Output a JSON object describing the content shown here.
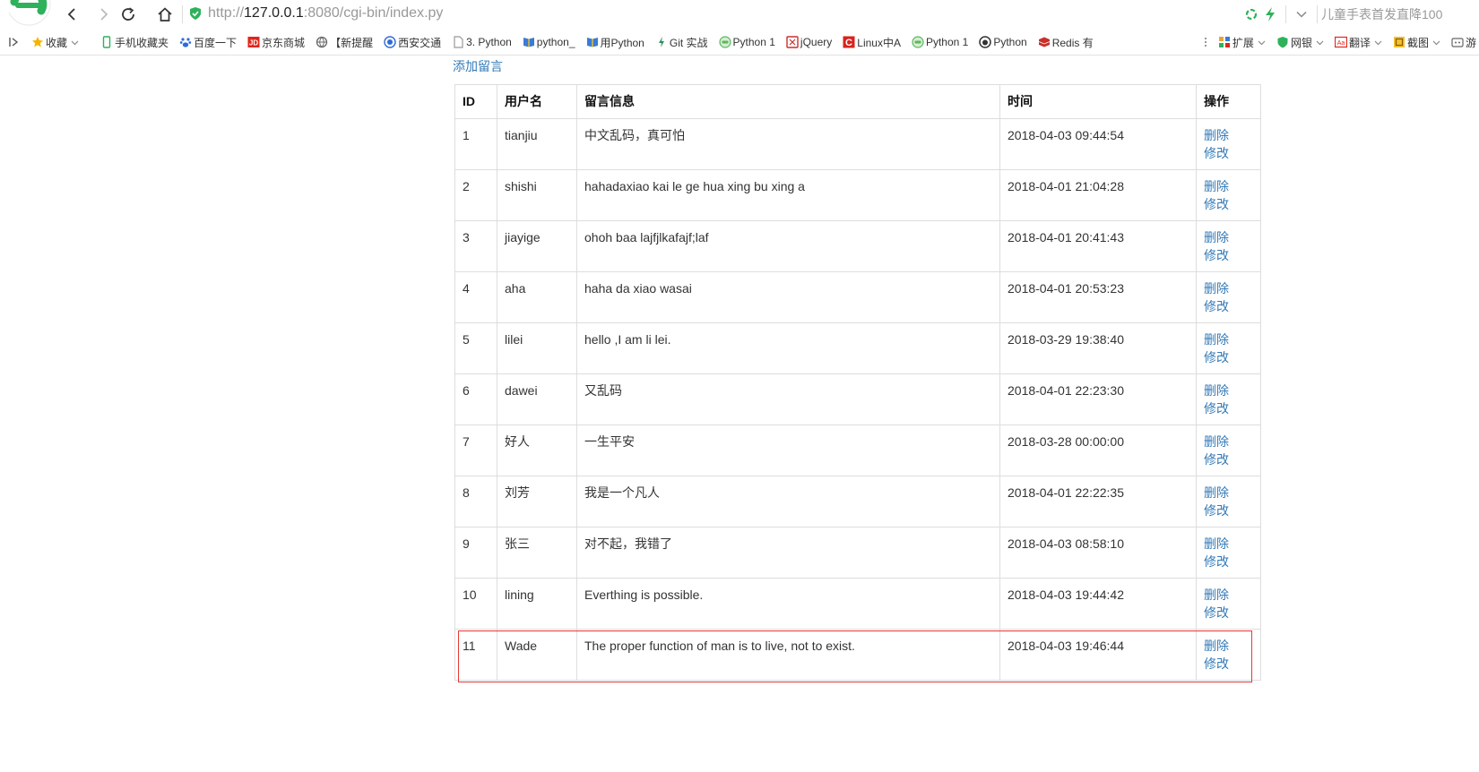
{
  "browser": {
    "address": {
      "scheme": "http://",
      "host": "127.0.0.1",
      "rest": ":8080/cgi-bin/index.py"
    },
    "promo_text": "儿童手表首发直降100",
    "accent": "#2fb15b"
  },
  "bookmarks": [
    {
      "label": "收藏",
      "icon": "star-icon",
      "color": "#f5b400"
    },
    {
      "label": "手机收藏夹",
      "icon": "phone-icon",
      "color": "#2fb15b"
    },
    {
      "label": "百度一下",
      "icon": "baidu-paw-icon",
      "color": "#2f6bd9"
    },
    {
      "label": "京东商城",
      "icon": "jd-icon",
      "color": "#e1251b"
    },
    {
      "label": "【新提醒",
      "icon": "globe-icon",
      "color": "#666666"
    },
    {
      "label": "西安交通",
      "icon": "emblem-icon",
      "color": "#2f6bd9"
    },
    {
      "label": "3. Python",
      "icon": "document-icon",
      "color": "#999999"
    },
    {
      "label": "python_",
      "icon": "python-flag-icon",
      "color": "#3a7bd5"
    },
    {
      "label": "用Python",
      "icon": "python-flag-icon",
      "color": "#3a7bd5"
    },
    {
      "label": "Git 实战",
      "icon": "git-icon",
      "color": "#2f8f5b"
    },
    {
      "label": "Python 1",
      "icon": "python-circle-icon",
      "color": "#5cb85c"
    },
    {
      "label": "jQuery",
      "icon": "jquery-icon",
      "color": "#c9302c"
    },
    {
      "label": "Linux中A",
      "icon": "c-logo-icon",
      "color": "#d9231c"
    },
    {
      "label": "Python 1",
      "icon": "python-circle-icon",
      "color": "#5cb85c"
    },
    {
      "label": "Python",
      "icon": "github-icon",
      "color": "#333333"
    },
    {
      "label": "Redis 有",
      "icon": "redis-icon",
      "color": "#c9302c"
    }
  ],
  "bookmark_tools": [
    {
      "label": "扩展",
      "icon": "extension-icon"
    },
    {
      "label": "网银",
      "icon": "shield-icon"
    },
    {
      "label": "翻译",
      "icon": "translate-icon"
    },
    {
      "label": "截图",
      "icon": "screenshot-icon"
    },
    {
      "label": "游",
      "icon": "game-icon"
    }
  ],
  "page": {
    "add_link": "添加留言",
    "columns": [
      "ID",
      "用户名",
      "留言信息",
      "时间",
      "操作"
    ],
    "delete_label": "删除",
    "edit_label": "修改",
    "rows": [
      {
        "id": "1",
        "user": "tianjiu",
        "msg": "中文乱码，真可怕",
        "time": "2018-04-03 09:44:54"
      },
      {
        "id": "2",
        "user": "shishi",
        "msg": "hahadaxiao kai le ge hua xing bu xing a",
        "time": "2018-04-01 21:04:28"
      },
      {
        "id": "3",
        "user": "jiayige",
        "msg": "ohoh baa lajfjlkafajf;laf",
        "time": "2018-04-01 20:41:43"
      },
      {
        "id": "4",
        "user": "aha",
        "msg": "haha da xiao wasai",
        "time": "2018-04-01 20:53:23"
      },
      {
        "id": "5",
        "user": "lilei",
        "msg": "hello ,I am li lei.",
        "time": "2018-03-29 19:38:40"
      },
      {
        "id": "6",
        "user": "dawei",
        "msg": "又乱码",
        "time": "2018-04-01 22:23:30"
      },
      {
        "id": "7",
        "user": "好人",
        "msg": "一生平安",
        "time": "2018-03-28 00:00:00"
      },
      {
        "id": "8",
        "user": "刘芳",
        "msg": "我是一个凡人",
        "time": "2018-04-01 22:22:35"
      },
      {
        "id": "9",
        "user": "张三",
        "msg": "对不起，我错了",
        "time": "2018-04-03 08:58:10"
      },
      {
        "id": "10",
        "user": "lining",
        "msg": "Everthing is possible.",
        "time": "2018-04-03 19:44:42"
      },
      {
        "id": "11",
        "user": "Wade",
        "msg": "The proper function of man is to live, not to exist.",
        "time": "2018-04-03 19:46:44"
      }
    ],
    "highlight_color": "#e53935"
  }
}
